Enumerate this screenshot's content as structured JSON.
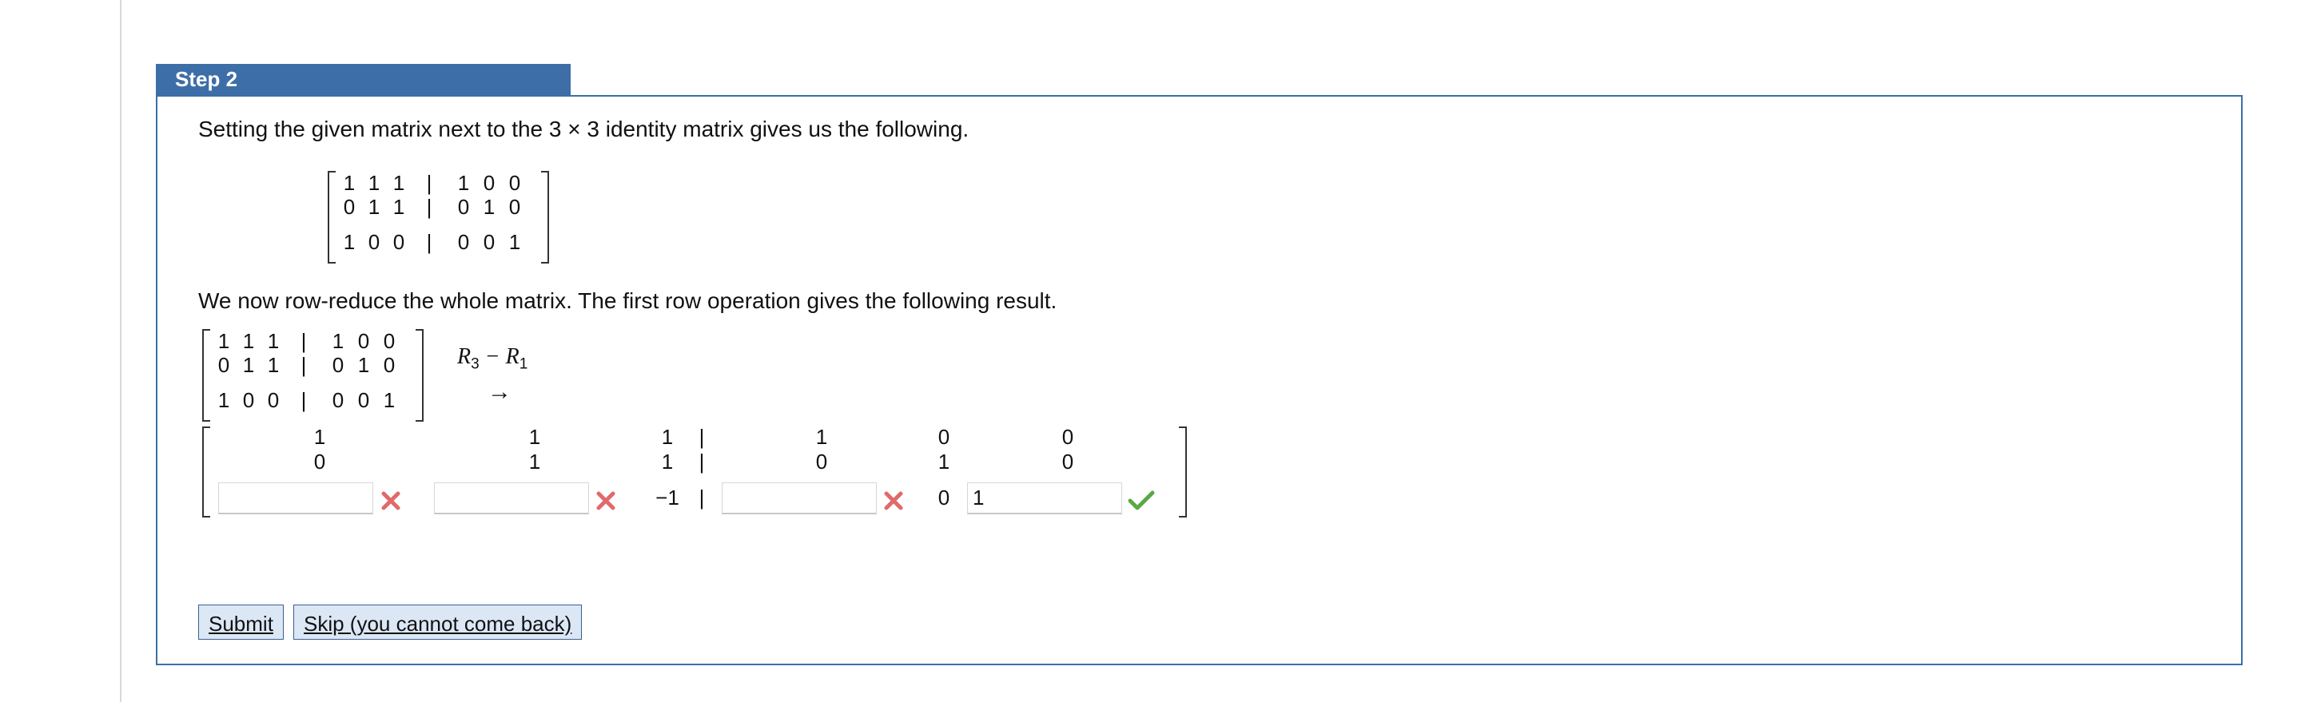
{
  "step": {
    "title": "Step 2",
    "intro_text": "Setting the given matrix next to the 3 × 3 identity matrix gives us the following.",
    "reduce_text": "We now row-reduce the whole matrix. The first row operation gives the following result."
  },
  "augmented_matrix": {
    "rows": [
      [
        "1",
        "1",
        "1",
        "|",
        "1",
        "0",
        "0"
      ],
      [
        "0",
        "1",
        "1",
        "|",
        "0",
        "1",
        "0"
      ],
      [
        "1",
        "0",
        "0",
        "|",
        "0",
        "0",
        "1"
      ]
    ]
  },
  "row_operation": {
    "label_main": "R",
    "label_sub1": "3",
    "label_minus": " − R",
    "label_sub2": "1",
    "arrow": "→"
  },
  "result_matrix": {
    "row1": [
      "1",
      "1",
      "1",
      "|",
      "1",
      "0",
      "0"
    ],
    "row2": [
      "0",
      "1",
      "1",
      "|",
      "0",
      "1",
      "0"
    ],
    "row3_fixed": {
      "c3": "−1",
      "bar": "|",
      "c5": "0"
    },
    "inputs": [
      {
        "value": "",
        "status": "incorrect"
      },
      {
        "value": "",
        "status": "incorrect"
      },
      {
        "value": "",
        "status": "incorrect"
      },
      {
        "value": "1",
        "status": "correct"
      }
    ]
  },
  "buttons": {
    "submit": "Submit",
    "skip": "Skip (you cannot come back)"
  },
  "colors": {
    "header_bg": "#3d6ea7",
    "incorrect": "#e06a6a",
    "correct": "#5aa846"
  }
}
